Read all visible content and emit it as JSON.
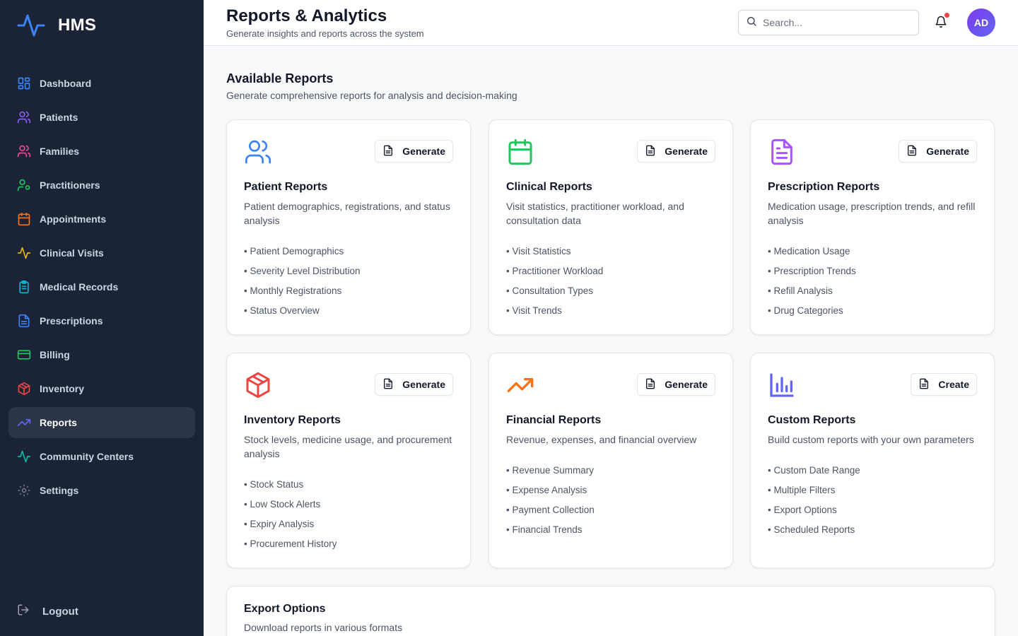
{
  "brand": {
    "name": "HMS",
    "logo_icon": "pulse-icon",
    "color": "#3b82f6"
  },
  "sidebar": {
    "items": [
      {
        "label": "Dashboard",
        "icon": "dashboard-icon",
        "color": "#3b82f6",
        "active": false
      },
      {
        "label": "Patients",
        "icon": "users-icon",
        "color": "#8b5cf6",
        "active": false
      },
      {
        "label": "Families",
        "icon": "users-icon",
        "color": "#ec4899",
        "active": false
      },
      {
        "label": "Practitioners",
        "icon": "user-cog-icon",
        "color": "#22c55e",
        "active": false
      },
      {
        "label": "Appointments",
        "icon": "calendar-icon",
        "color": "#f97316",
        "active": false
      },
      {
        "label": "Clinical Visits",
        "icon": "activity-icon",
        "color": "#eab308",
        "active": false
      },
      {
        "label": "Medical Records",
        "icon": "clipboard-icon",
        "color": "#06b6d4",
        "active": false
      },
      {
        "label": "Prescriptions",
        "icon": "file-text-icon",
        "color": "#3b82f6",
        "active": false
      },
      {
        "label": "Billing",
        "icon": "credit-card-icon",
        "color": "#22c55e",
        "active": false
      },
      {
        "label": "Inventory",
        "icon": "package-icon",
        "color": "#ef4444",
        "active": false
      },
      {
        "label": "Reports",
        "icon": "trending-up-icon",
        "color": "#6366f1",
        "active": true
      },
      {
        "label": "Community Centers",
        "icon": "activity-icon",
        "color": "#14b8a6",
        "active": false
      },
      {
        "label": "Settings",
        "icon": "gear-icon",
        "color": "#6b7280",
        "active": false
      }
    ],
    "logout_label": "Logout"
  },
  "header": {
    "title": "Reports & Analytics",
    "subtitle": "Generate insights and reports across the system",
    "search_placeholder": "Search...",
    "avatar_initials": "AD"
  },
  "main": {
    "section_title": "Available Reports",
    "section_subtitle": "Generate comprehensive reports for analysis and decision-making",
    "cards": [
      {
        "title": "Patient Reports",
        "description": "Patient demographics, registrations, and status analysis",
        "button": "Generate",
        "icon": "users-icon",
        "color": "#3b82f6",
        "items": [
          "• Patient Demographics",
          "• Severity Level Distribution",
          "• Monthly Registrations",
          "• Status Overview"
        ]
      },
      {
        "title": "Clinical Reports",
        "description": "Visit statistics, practitioner workload, and consultation data",
        "button": "Generate",
        "icon": "calendar-icon",
        "color": "#22c55e",
        "items": [
          "• Visit Statistics",
          "• Practitioner Workload",
          "• Consultation Types",
          "• Visit Trends"
        ]
      },
      {
        "title": "Prescription Reports",
        "description": "Medication usage, prescription trends, and refill analysis",
        "button": "Generate",
        "icon": "file-text-icon",
        "color": "#a855f7",
        "items": [
          "• Medication Usage",
          "• Prescription Trends",
          "• Refill Analysis",
          "• Drug Categories"
        ]
      },
      {
        "title": "Inventory Reports",
        "description": "Stock levels, medicine usage, and procurement analysis",
        "button": "Generate",
        "icon": "package-icon",
        "color": "#ef4444",
        "items": [
          "• Stock Status",
          "• Low Stock Alerts",
          "• Expiry Analysis",
          "• Procurement History"
        ]
      },
      {
        "title": "Financial Reports",
        "description": "Revenue, expenses, and financial overview",
        "button": "Generate",
        "icon": "trending-up-icon",
        "color": "#f97316",
        "items": [
          "• Revenue Summary",
          "• Expense Analysis",
          "• Payment Collection",
          "• Financial Trends"
        ]
      },
      {
        "title": "Custom Reports",
        "description": "Build custom reports with your own parameters",
        "button": "Create",
        "icon": "bar-chart-icon",
        "color": "#6366f1",
        "items": [
          "• Custom Date Range",
          "• Multiple Filters",
          "• Export Options",
          "• Scheduled Reports"
        ]
      }
    ],
    "export": {
      "title": "Export Options",
      "subtitle": "Download reports in various formats"
    }
  }
}
